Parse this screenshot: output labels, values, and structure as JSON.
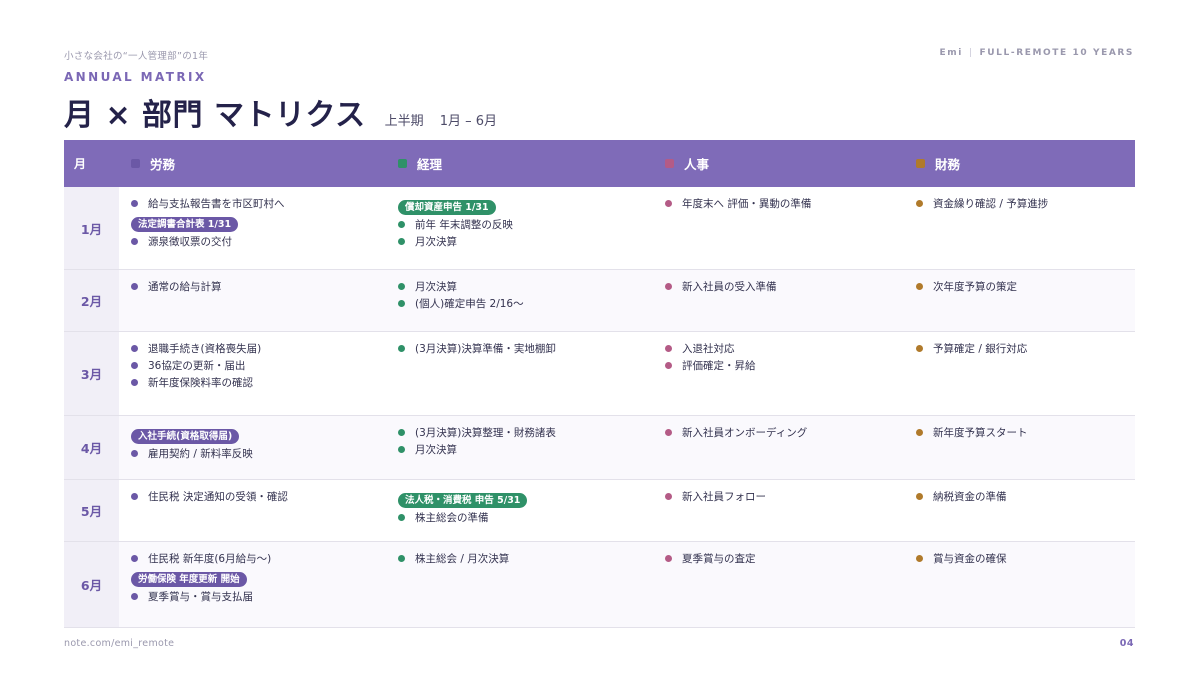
{
  "header": {
    "series": "小さな会社の“一人管理部”の1年",
    "brand_name": "Emi",
    "brand_tag": "FULL-REMOTE 10 YEARS"
  },
  "eyebrow": "ANNUAL MATRIX",
  "title": "月 × 部門 マトリクス",
  "subtitle": "上半期",
  "subtitle_range": "1月 – 6月",
  "colors": {
    "header_bg": "#7f6bb8",
    "labor": "#6b58a6",
    "accounting": "#2f9168",
    "hr": "#b45b86",
    "finance": "#b07a2b"
  },
  "columns": {
    "month": "月",
    "labor": "労務",
    "accounting": "経理",
    "hr": "人事",
    "finance": "財務"
  },
  "rows": [
    {
      "month": "1月",
      "labor": [
        {
          "type": "item",
          "text": "給与支払報告書を市区町村へ"
        },
        {
          "type": "badge",
          "text": "法定調書合計表 1/31"
        },
        {
          "type": "item",
          "text": "源泉徴収票の交付"
        }
      ],
      "accounting": [
        {
          "type": "badge",
          "text": "償却資産申告 1/31"
        },
        {
          "type": "item",
          "text": "前年 年末調整の反映"
        },
        {
          "type": "item",
          "text": "月次決算"
        }
      ],
      "hr": [
        {
          "type": "item",
          "text": "年度末へ 評価・異動の準備"
        }
      ],
      "finance": [
        {
          "type": "item",
          "text": "資金繰り確認 / 予算進捗"
        }
      ]
    },
    {
      "month": "2月",
      "labor": [
        {
          "type": "item",
          "text": "通常の給与計算"
        }
      ],
      "accounting": [
        {
          "type": "item",
          "text": "月次決算"
        },
        {
          "type": "item",
          "text": "(個人)確定申告 2/16〜"
        }
      ],
      "hr": [
        {
          "type": "item",
          "text": "新入社員の受入準備"
        }
      ],
      "finance": [
        {
          "type": "item",
          "text": "次年度予算の策定"
        }
      ]
    },
    {
      "month": "3月",
      "labor": [
        {
          "type": "item",
          "text": "退職手続き(資格喪失届)"
        },
        {
          "type": "item",
          "text": "36協定の更新・届出"
        },
        {
          "type": "item",
          "text": "新年度保険料率の確認"
        }
      ],
      "accounting": [
        {
          "type": "item",
          "text": "(3月決算)決算準備・実地棚卸"
        }
      ],
      "hr": [
        {
          "type": "item",
          "text": "入退社対応"
        },
        {
          "type": "item",
          "text": "評価確定・昇給"
        }
      ],
      "finance": [
        {
          "type": "item",
          "text": "予算確定 / 銀行対応"
        }
      ]
    },
    {
      "month": "4月",
      "labor": [
        {
          "type": "badge",
          "text": "入社手続(資格取得届)"
        },
        {
          "type": "item",
          "text": "雇用契約 / 新料率反映"
        }
      ],
      "accounting": [
        {
          "type": "item",
          "text": "(3月決算)決算整理・財務諸表"
        },
        {
          "type": "item",
          "text": "月次決算"
        }
      ],
      "hr": [
        {
          "type": "item",
          "text": "新入社員オンボーディング"
        }
      ],
      "finance": [
        {
          "type": "item",
          "text": "新年度予算スタート"
        }
      ]
    },
    {
      "month": "5月",
      "labor": [
        {
          "type": "item",
          "text": "住民税 決定通知の受領・確認"
        }
      ],
      "accounting": [
        {
          "type": "badge",
          "text": "法人税・消費税 申告 5/31"
        },
        {
          "type": "item",
          "text": "株主総会の準備"
        }
      ],
      "hr": [
        {
          "type": "item",
          "text": "新入社員フォロー"
        }
      ],
      "finance": [
        {
          "type": "item",
          "text": "納税資金の準備"
        }
      ]
    },
    {
      "month": "6月",
      "labor": [
        {
          "type": "item",
          "text": "住民税 新年度(6月給与〜)"
        },
        {
          "type": "badge",
          "text": "労働保険 年度更新 開始"
        },
        {
          "type": "item",
          "text": "夏季賞与・賞与支払届"
        }
      ],
      "accounting": [
        {
          "type": "item",
          "text": "株主総会 / 月次決算"
        }
      ],
      "hr": [
        {
          "type": "item",
          "text": "夏季賞与の査定"
        }
      ],
      "finance": [
        {
          "type": "item",
          "text": "賞与資金の確保"
        }
      ]
    }
  ],
  "footer": {
    "url": "note.com/emi_remote",
    "page": "04"
  }
}
